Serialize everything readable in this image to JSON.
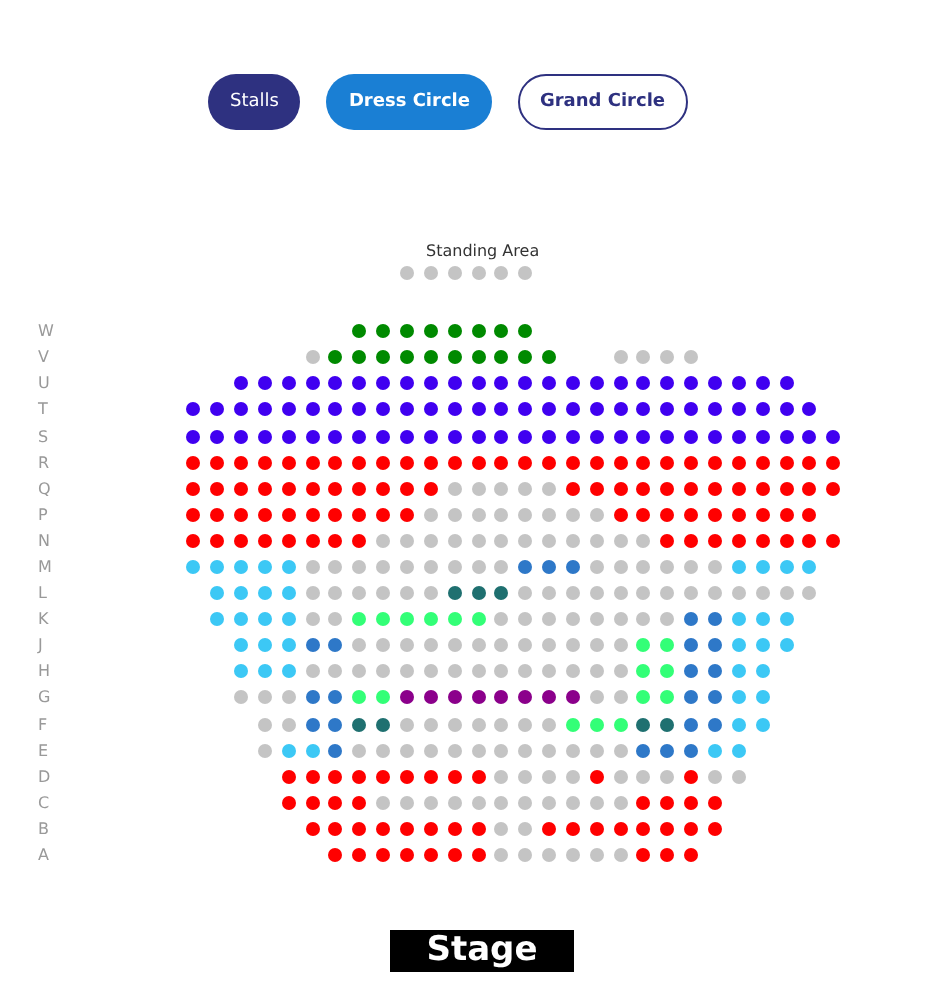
{
  "section_tabs": [
    {
      "label": "Stalls",
      "kind": "dark"
    },
    {
      "label": "Dress Circle",
      "kind": "primary"
    },
    {
      "label": "Grand Circle",
      "kind": "outline"
    }
  ],
  "standing_area": {
    "label": "Standing Area",
    "seats": [
      {
        "kind": "gap"
      },
      {
        "kind": "gap"
      },
      {
        "kind": "gap"
      },
      {
        "kind": "gap"
      },
      {
        "kind": "gap"
      },
      {
        "kind": "gap"
      },
      {
        "kind": "gap"
      },
      {
        "kind": "gap"
      },
      {
        "kind": "gap"
      },
      {
        "color": "#c4c4c4"
      },
      {
        "color": "#c4c4c4"
      },
      {
        "color": "#c4c4c4"
      },
      {
        "color": "#c4c4c4"
      },
      {
        "color": "#c4c4c4"
      },
      {
        "color": "#c4c4c4"
      }
    ]
  },
  "rows": [
    {
      "label": "W",
      "seats": [
        {
          "kind": "gap"
        },
        {
          "kind": "gap"
        },
        {
          "kind": "gap"
        },
        {
          "kind": "gap"
        },
        {
          "kind": "gap"
        },
        {
          "kind": "gap"
        },
        {
          "kind": "gap"
        },
        {
          "color": "#008a00"
        },
        {
          "color": "#008a00"
        },
        {
          "color": "#008a00"
        },
        {
          "color": "#008a00"
        },
        {
          "color": "#008a00"
        },
        {
          "color": "#008a00"
        },
        {
          "color": "#008a00"
        },
        {
          "color": "#008a00"
        }
      ]
    },
    {
      "label": "V",
      "seats": [
        {
          "kind": "gap"
        },
        {
          "kind": "gap"
        },
        {
          "kind": "gap"
        },
        {
          "kind": "gap"
        },
        {
          "kind": "gap"
        },
        {
          "color": "#c4c4c4"
        },
        {
          "color": "#008a00"
        },
        {
          "color": "#008a00"
        },
        {
          "color": "#008a00"
        },
        {
          "color": "#008a00"
        },
        {
          "color": "#008a00"
        },
        {
          "color": "#008a00"
        },
        {
          "color": "#008a00"
        },
        {
          "color": "#008a00"
        },
        {
          "color": "#008a00"
        },
        {
          "color": "#008a00"
        },
        {
          "kind": "gap"
        },
        {
          "kind": "gap"
        },
        {
          "color": "#c4c4c4"
        },
        {
          "color": "#c4c4c4"
        },
        {
          "color": "#c4c4c4"
        },
        {
          "color": "#c4c4c4"
        }
      ]
    },
    {
      "label": "U",
      "seats": [
        {
          "kind": "gap"
        },
        {
          "kind": "gap"
        },
        {
          "color": "#4000f0"
        },
        {
          "color": "#4000f0"
        },
        {
          "color": "#4000f0"
        },
        {
          "color": "#4000f0"
        },
        {
          "color": "#4000f0"
        },
        {
          "color": "#4000f0"
        },
        {
          "color": "#4000f0"
        },
        {
          "color": "#4000f0"
        },
        {
          "color": "#4000f0"
        },
        {
          "color": "#4000f0"
        },
        {
          "color": "#4000f0"
        },
        {
          "color": "#4000f0"
        },
        {
          "color": "#4000f0"
        },
        {
          "color": "#4000f0"
        },
        {
          "color": "#4000f0"
        },
        {
          "color": "#4000f0"
        },
        {
          "color": "#4000f0"
        },
        {
          "color": "#4000f0"
        },
        {
          "color": "#4000f0"
        },
        {
          "color": "#4000f0"
        },
        {
          "color": "#4000f0"
        },
        {
          "color": "#4000f0"
        },
        {
          "color": "#4000f0"
        },
        {
          "color": "#4000f0"
        }
      ]
    },
    {
      "label": "T",
      "seats": [
        {
          "color": "#4000f0"
        },
        {
          "color": "#4000f0"
        },
        {
          "color": "#4000f0"
        },
        {
          "color": "#4000f0"
        },
        {
          "color": "#4000f0"
        },
        {
          "color": "#4000f0"
        },
        {
          "color": "#4000f0"
        },
        {
          "color": "#4000f0"
        },
        {
          "color": "#4000f0"
        },
        {
          "color": "#4000f0"
        },
        {
          "color": "#4000f0"
        },
        {
          "color": "#4000f0"
        },
        {
          "color": "#4000f0"
        },
        {
          "color": "#4000f0"
        },
        {
          "color": "#4000f0"
        },
        {
          "color": "#4000f0"
        },
        {
          "color": "#4000f0"
        },
        {
          "color": "#4000f0"
        },
        {
          "color": "#4000f0"
        },
        {
          "color": "#4000f0"
        },
        {
          "color": "#4000f0"
        },
        {
          "color": "#4000f0"
        },
        {
          "color": "#4000f0"
        },
        {
          "color": "#4000f0"
        },
        {
          "color": "#4000f0"
        },
        {
          "color": "#4000f0"
        },
        {
          "color": "#4000f0"
        }
      ]
    },
    {
      "label": "S",
      "seats": [
        {
          "color": "#4000f0"
        },
        {
          "color": "#4000f0"
        },
        {
          "color": "#4000f0"
        },
        {
          "color": "#4000f0"
        },
        {
          "color": "#4000f0"
        },
        {
          "color": "#4000f0"
        },
        {
          "color": "#4000f0"
        },
        {
          "color": "#4000f0"
        },
        {
          "color": "#4000f0"
        },
        {
          "color": "#4000f0"
        },
        {
          "color": "#4000f0"
        },
        {
          "color": "#4000f0"
        },
        {
          "color": "#4000f0"
        },
        {
          "color": "#4000f0"
        },
        {
          "color": "#4000f0"
        },
        {
          "color": "#4000f0"
        },
        {
          "color": "#4000f0"
        },
        {
          "color": "#4000f0"
        },
        {
          "color": "#4000f0"
        },
        {
          "color": "#4000f0"
        },
        {
          "color": "#4000f0"
        },
        {
          "color": "#4000f0"
        },
        {
          "color": "#4000f0"
        },
        {
          "color": "#4000f0"
        },
        {
          "color": "#4000f0"
        },
        {
          "color": "#4000f0"
        },
        {
          "color": "#4000f0"
        },
        {
          "color": "#4000f0"
        }
      ]
    },
    {
      "label": "R",
      "seats": [
        {
          "color": "#ff0000"
        },
        {
          "color": "#ff0000"
        },
        {
          "color": "#ff0000"
        },
        {
          "color": "#ff0000"
        },
        {
          "color": "#ff0000"
        },
        {
          "color": "#ff0000"
        },
        {
          "color": "#ff0000"
        },
        {
          "color": "#ff0000"
        },
        {
          "color": "#ff0000"
        },
        {
          "color": "#ff0000"
        },
        {
          "color": "#ff0000"
        },
        {
          "color": "#ff0000"
        },
        {
          "color": "#ff0000"
        },
        {
          "color": "#ff0000"
        },
        {
          "color": "#ff0000"
        },
        {
          "color": "#ff0000"
        },
        {
          "color": "#ff0000"
        },
        {
          "color": "#ff0000"
        },
        {
          "color": "#ff0000"
        },
        {
          "color": "#ff0000"
        },
        {
          "color": "#ff0000"
        },
        {
          "color": "#ff0000"
        },
        {
          "color": "#ff0000"
        },
        {
          "color": "#ff0000"
        },
        {
          "color": "#ff0000"
        },
        {
          "color": "#ff0000"
        },
        {
          "color": "#ff0000"
        },
        {
          "color": "#ff0000"
        }
      ]
    },
    {
      "label": "Q",
      "seats": [
        {
          "color": "#ff0000"
        },
        {
          "color": "#ff0000"
        },
        {
          "color": "#ff0000"
        },
        {
          "color": "#ff0000"
        },
        {
          "color": "#ff0000"
        },
        {
          "color": "#ff0000"
        },
        {
          "color": "#ff0000"
        },
        {
          "color": "#ff0000"
        },
        {
          "color": "#ff0000"
        },
        {
          "color": "#ff0000"
        },
        {
          "color": "#ff0000"
        },
        {
          "color": "#c4c4c4"
        },
        {
          "color": "#c4c4c4"
        },
        {
          "color": "#c4c4c4"
        },
        {
          "color": "#c4c4c4"
        },
        {
          "color": "#c4c4c4"
        },
        {
          "color": "#ff0000"
        },
        {
          "color": "#ff0000"
        },
        {
          "color": "#ff0000"
        },
        {
          "color": "#ff0000"
        },
        {
          "color": "#ff0000"
        },
        {
          "color": "#ff0000"
        },
        {
          "color": "#ff0000"
        },
        {
          "color": "#ff0000"
        },
        {
          "color": "#ff0000"
        },
        {
          "color": "#ff0000"
        },
        {
          "color": "#ff0000"
        },
        {
          "color": "#ff0000"
        }
      ]
    },
    {
      "label": "P",
      "seats": [
        {
          "color": "#ff0000"
        },
        {
          "color": "#ff0000"
        },
        {
          "color": "#ff0000"
        },
        {
          "color": "#ff0000"
        },
        {
          "color": "#ff0000"
        },
        {
          "color": "#ff0000"
        },
        {
          "color": "#ff0000"
        },
        {
          "color": "#ff0000"
        },
        {
          "color": "#ff0000"
        },
        {
          "color": "#ff0000"
        },
        {
          "color": "#c4c4c4"
        },
        {
          "color": "#c4c4c4"
        },
        {
          "color": "#c4c4c4"
        },
        {
          "color": "#c4c4c4"
        },
        {
          "color": "#c4c4c4"
        },
        {
          "color": "#c4c4c4"
        },
        {
          "color": "#c4c4c4"
        },
        {
          "color": "#c4c4c4"
        },
        {
          "color": "#ff0000"
        },
        {
          "color": "#ff0000"
        },
        {
          "color": "#ff0000"
        },
        {
          "color": "#ff0000"
        },
        {
          "color": "#ff0000"
        },
        {
          "color": "#ff0000"
        },
        {
          "color": "#ff0000"
        },
        {
          "color": "#ff0000"
        },
        {
          "color": "#ff0000"
        }
      ]
    },
    {
      "label": "N",
      "seats": [
        {
          "color": "#ff0000"
        },
        {
          "color": "#ff0000"
        },
        {
          "color": "#ff0000"
        },
        {
          "color": "#ff0000"
        },
        {
          "color": "#ff0000"
        },
        {
          "color": "#ff0000"
        },
        {
          "color": "#ff0000"
        },
        {
          "color": "#ff0000"
        },
        {
          "color": "#c4c4c4"
        },
        {
          "color": "#c4c4c4"
        },
        {
          "color": "#c4c4c4"
        },
        {
          "color": "#c4c4c4"
        },
        {
          "color": "#c4c4c4"
        },
        {
          "color": "#c4c4c4"
        },
        {
          "color": "#c4c4c4"
        },
        {
          "color": "#c4c4c4"
        },
        {
          "color": "#c4c4c4"
        },
        {
          "color": "#c4c4c4"
        },
        {
          "color": "#c4c4c4"
        },
        {
          "color": "#c4c4c4"
        },
        {
          "color": "#ff0000"
        },
        {
          "color": "#ff0000"
        },
        {
          "color": "#ff0000"
        },
        {
          "color": "#ff0000"
        },
        {
          "color": "#ff0000"
        },
        {
          "color": "#ff0000"
        },
        {
          "color": "#ff0000"
        },
        {
          "color": "#ff0000"
        }
      ]
    },
    {
      "label": "M",
      "seats": [
        {
          "color": "#3cc8f5"
        },
        {
          "color": "#3cc8f5"
        },
        {
          "color": "#3cc8f5"
        },
        {
          "color": "#3cc8f5"
        },
        {
          "color": "#3cc8f5"
        },
        {
          "color": "#c4c4c4"
        },
        {
          "color": "#c4c4c4"
        },
        {
          "color": "#c4c4c4"
        },
        {
          "color": "#c4c4c4"
        },
        {
          "color": "#c4c4c4"
        },
        {
          "color": "#c4c4c4"
        },
        {
          "color": "#c4c4c4"
        },
        {
          "color": "#c4c4c4"
        },
        {
          "color": "#c4c4c4"
        },
        {
          "color": "#2e78c8"
        },
        {
          "color": "#2e78c8"
        },
        {
          "color": "#2e78c8"
        },
        {
          "color": "#c4c4c4"
        },
        {
          "color": "#c4c4c4"
        },
        {
          "color": "#c4c4c4"
        },
        {
          "color": "#c4c4c4"
        },
        {
          "color": "#c4c4c4"
        },
        {
          "color": "#c4c4c4"
        },
        {
          "color": "#3cc8f5"
        },
        {
          "color": "#3cc8f5"
        },
        {
          "color": "#3cc8f5"
        },
        {
          "color": "#3cc8f5"
        }
      ]
    },
    {
      "label": "L",
      "seats": [
        {
          "kind": "gap"
        },
        {
          "color": "#3cc8f5"
        },
        {
          "color": "#3cc8f5"
        },
        {
          "color": "#3cc8f5"
        },
        {
          "color": "#3cc8f5"
        },
        {
          "color": "#c4c4c4"
        },
        {
          "color": "#c4c4c4"
        },
        {
          "color": "#c4c4c4"
        },
        {
          "color": "#c4c4c4"
        },
        {
          "color": "#c4c4c4"
        },
        {
          "color": "#c4c4c4"
        },
        {
          "color": "#1f7070"
        },
        {
          "color": "#1f7070"
        },
        {
          "color": "#1f7070"
        },
        {
          "color": "#c4c4c4"
        },
        {
          "color": "#c4c4c4"
        },
        {
          "color": "#c4c4c4"
        },
        {
          "color": "#c4c4c4"
        },
        {
          "color": "#c4c4c4"
        },
        {
          "color": "#c4c4c4"
        },
        {
          "color": "#c4c4c4"
        },
        {
          "color": "#c4c4c4"
        },
        {
          "color": "#c4c4c4"
        },
        {
          "color": "#c4c4c4"
        },
        {
          "color": "#c4c4c4"
        },
        {
          "color": "#c4c4c4"
        },
        {
          "color": "#c4c4c4"
        }
      ]
    },
    {
      "label": "K",
      "seats": [
        {
          "kind": "gap"
        },
        {
          "color": "#3cc8f5"
        },
        {
          "color": "#3cc8f5"
        },
        {
          "color": "#3cc8f5"
        },
        {
          "color": "#3cc8f5"
        },
        {
          "color": "#c4c4c4"
        },
        {
          "color": "#c4c4c4"
        },
        {
          "color": "#33ff77"
        },
        {
          "color": "#33ff77"
        },
        {
          "color": "#33ff77"
        },
        {
          "color": "#33ff77"
        },
        {
          "color": "#33ff77"
        },
        {
          "color": "#33ff77"
        },
        {
          "color": "#c4c4c4"
        },
        {
          "color": "#c4c4c4"
        },
        {
          "color": "#c4c4c4"
        },
        {
          "color": "#c4c4c4"
        },
        {
          "color": "#c4c4c4"
        },
        {
          "color": "#c4c4c4"
        },
        {
          "color": "#c4c4c4"
        },
        {
          "color": "#c4c4c4"
        },
        {
          "color": "#2e78c8"
        },
        {
          "color": "#2e78c8"
        },
        {
          "color": "#3cc8f5"
        },
        {
          "color": "#3cc8f5"
        },
        {
          "color": "#3cc8f5"
        }
      ]
    },
    {
      "label": "J",
      "seats": [
        {
          "kind": "gap"
        },
        {
          "kind": "gap"
        },
        {
          "color": "#3cc8f5"
        },
        {
          "color": "#3cc8f5"
        },
        {
          "color": "#3cc8f5"
        },
        {
          "color": "#2e78c8"
        },
        {
          "color": "#2e78c8"
        },
        {
          "color": "#c4c4c4"
        },
        {
          "color": "#c4c4c4"
        },
        {
          "color": "#c4c4c4"
        },
        {
          "color": "#c4c4c4"
        },
        {
          "color": "#c4c4c4"
        },
        {
          "color": "#c4c4c4"
        },
        {
          "color": "#c4c4c4"
        },
        {
          "color": "#c4c4c4"
        },
        {
          "color": "#c4c4c4"
        },
        {
          "color": "#c4c4c4"
        },
        {
          "color": "#c4c4c4"
        },
        {
          "color": "#c4c4c4"
        },
        {
          "color": "#33ff77"
        },
        {
          "color": "#33ff77"
        },
        {
          "color": "#2e78c8"
        },
        {
          "color": "#2e78c8"
        },
        {
          "color": "#3cc8f5"
        },
        {
          "color": "#3cc8f5"
        },
        {
          "color": "#3cc8f5"
        }
      ]
    },
    {
      "label": "H",
      "seats": [
        {
          "kind": "gap"
        },
        {
          "kind": "gap"
        },
        {
          "color": "#3cc8f5"
        },
        {
          "color": "#3cc8f5"
        },
        {
          "color": "#3cc8f5"
        },
        {
          "color": "#c4c4c4"
        },
        {
          "color": "#c4c4c4"
        },
        {
          "color": "#c4c4c4"
        },
        {
          "color": "#c4c4c4"
        },
        {
          "color": "#c4c4c4"
        },
        {
          "color": "#c4c4c4"
        },
        {
          "color": "#c4c4c4"
        },
        {
          "color": "#c4c4c4"
        },
        {
          "color": "#c4c4c4"
        },
        {
          "color": "#c4c4c4"
        },
        {
          "color": "#c4c4c4"
        },
        {
          "color": "#c4c4c4"
        },
        {
          "color": "#c4c4c4"
        },
        {
          "color": "#c4c4c4"
        },
        {
          "color": "#33ff77"
        },
        {
          "color": "#33ff77"
        },
        {
          "color": "#2e78c8"
        },
        {
          "color": "#2e78c8"
        },
        {
          "color": "#3cc8f5"
        },
        {
          "color": "#3cc8f5"
        }
      ]
    },
    {
      "label": "G",
      "seats": [
        {
          "kind": "gap"
        },
        {
          "kind": "gap"
        },
        {
          "color": "#c4c4c4"
        },
        {
          "color": "#c4c4c4"
        },
        {
          "color": "#c4c4c4"
        },
        {
          "color": "#2e78c8"
        },
        {
          "color": "#2e78c8"
        },
        {
          "color": "#33ff77"
        },
        {
          "color": "#33ff77"
        },
        {
          "color": "#8b008b"
        },
        {
          "color": "#8b008b"
        },
        {
          "color": "#8b008b"
        },
        {
          "color": "#8b008b"
        },
        {
          "color": "#8b008b"
        },
        {
          "color": "#8b008b"
        },
        {
          "color": "#8b008b"
        },
        {
          "color": "#8b008b"
        },
        {
          "color": "#c4c4c4"
        },
        {
          "color": "#c4c4c4"
        },
        {
          "color": "#33ff77"
        },
        {
          "color": "#33ff77"
        },
        {
          "color": "#2e78c8"
        },
        {
          "color": "#2e78c8"
        },
        {
          "color": "#3cc8f5"
        },
        {
          "color": "#3cc8f5"
        }
      ]
    },
    {
      "label": "F",
      "seats": [
        {
          "kind": "gap"
        },
        {
          "kind": "gap"
        },
        {
          "kind": "gap"
        },
        {
          "color": "#c4c4c4"
        },
        {
          "color": "#c4c4c4"
        },
        {
          "color": "#2e78c8"
        },
        {
          "color": "#2e78c8"
        },
        {
          "color": "#1f7070"
        },
        {
          "color": "#1f7070"
        },
        {
          "color": "#c4c4c4"
        },
        {
          "color": "#c4c4c4"
        },
        {
          "color": "#c4c4c4"
        },
        {
          "color": "#c4c4c4"
        },
        {
          "color": "#c4c4c4"
        },
        {
          "color": "#c4c4c4"
        },
        {
          "color": "#c4c4c4"
        },
        {
          "color": "#33ff77"
        },
        {
          "color": "#33ff77"
        },
        {
          "color": "#33ff77"
        },
        {
          "color": "#1f7070"
        },
        {
          "color": "#1f7070"
        },
        {
          "color": "#2e78c8"
        },
        {
          "color": "#2e78c8"
        },
        {
          "color": "#3cc8f5"
        },
        {
          "color": "#3cc8f5"
        }
      ]
    },
    {
      "label": "E",
      "seats": [
        {
          "kind": "gap"
        },
        {
          "kind": "gap"
        },
        {
          "kind": "gap"
        },
        {
          "color": "#c4c4c4"
        },
        {
          "color": "#3cc8f5"
        },
        {
          "color": "#3cc8f5"
        },
        {
          "color": "#2e78c8"
        },
        {
          "color": "#c4c4c4"
        },
        {
          "color": "#c4c4c4"
        },
        {
          "color": "#c4c4c4"
        },
        {
          "color": "#c4c4c4"
        },
        {
          "color": "#c4c4c4"
        },
        {
          "color": "#c4c4c4"
        },
        {
          "color": "#c4c4c4"
        },
        {
          "color": "#c4c4c4"
        },
        {
          "color": "#c4c4c4"
        },
        {
          "color": "#c4c4c4"
        },
        {
          "color": "#c4c4c4"
        },
        {
          "color": "#c4c4c4"
        },
        {
          "color": "#2e78c8"
        },
        {
          "color": "#2e78c8"
        },
        {
          "color": "#2e78c8"
        },
        {
          "color": "#3cc8f5"
        },
        {
          "color": "#3cc8f5"
        }
      ]
    },
    {
      "label": "D",
      "seats": [
        {
          "kind": "gap"
        },
        {
          "kind": "gap"
        },
        {
          "kind": "gap"
        },
        {
          "kind": "gap"
        },
        {
          "color": "#ff0000"
        },
        {
          "color": "#ff0000"
        },
        {
          "color": "#ff0000"
        },
        {
          "color": "#ff0000"
        },
        {
          "color": "#ff0000"
        },
        {
          "color": "#ff0000"
        },
        {
          "color": "#ff0000"
        },
        {
          "color": "#ff0000"
        },
        {
          "color": "#ff0000"
        },
        {
          "color": "#c4c4c4"
        },
        {
          "color": "#c4c4c4"
        },
        {
          "color": "#c4c4c4"
        },
        {
          "color": "#c4c4c4"
        },
        {
          "color": "#ff0000"
        },
        {
          "color": "#c4c4c4"
        },
        {
          "color": "#c4c4c4"
        },
        {
          "color": "#c4c4c4"
        },
        {
          "color": "#ff0000"
        },
        {
          "color": "#c4c4c4"
        },
        {
          "color": "#c4c4c4"
        }
      ]
    },
    {
      "label": "C",
      "seats": [
        {
          "kind": "gap"
        },
        {
          "kind": "gap"
        },
        {
          "kind": "gap"
        },
        {
          "kind": "gap"
        },
        {
          "color": "#ff0000"
        },
        {
          "color": "#ff0000"
        },
        {
          "color": "#ff0000"
        },
        {
          "color": "#ff0000"
        },
        {
          "color": "#c4c4c4"
        },
        {
          "color": "#c4c4c4"
        },
        {
          "color": "#c4c4c4"
        },
        {
          "color": "#c4c4c4"
        },
        {
          "color": "#c4c4c4"
        },
        {
          "color": "#c4c4c4"
        },
        {
          "color": "#c4c4c4"
        },
        {
          "color": "#c4c4c4"
        },
        {
          "color": "#c4c4c4"
        },
        {
          "color": "#c4c4c4"
        },
        {
          "color": "#c4c4c4"
        },
        {
          "color": "#ff0000"
        },
        {
          "color": "#ff0000"
        },
        {
          "color": "#ff0000"
        },
        {
          "color": "#ff0000"
        }
      ]
    },
    {
      "label": "B",
      "seats": [
        {
          "kind": "gap"
        },
        {
          "kind": "gap"
        },
        {
          "kind": "gap"
        },
        {
          "kind": "gap"
        },
        {
          "kind": "gap"
        },
        {
          "color": "#ff0000"
        },
        {
          "color": "#ff0000"
        },
        {
          "color": "#ff0000"
        },
        {
          "color": "#ff0000"
        },
        {
          "color": "#ff0000"
        },
        {
          "color": "#ff0000"
        },
        {
          "color": "#ff0000"
        },
        {
          "color": "#ff0000"
        },
        {
          "color": "#c4c4c4"
        },
        {
          "color": "#c4c4c4"
        },
        {
          "color": "#ff0000"
        },
        {
          "color": "#ff0000"
        },
        {
          "color": "#ff0000"
        },
        {
          "color": "#ff0000"
        },
        {
          "color": "#ff0000"
        },
        {
          "color": "#ff0000"
        },
        {
          "color": "#ff0000"
        },
        {
          "color": "#ff0000"
        }
      ]
    },
    {
      "label": "A",
      "seats": [
        {
          "kind": "gap"
        },
        {
          "kind": "gap"
        },
        {
          "kind": "gap"
        },
        {
          "kind": "gap"
        },
        {
          "kind": "gap"
        },
        {
          "kind": "gap"
        },
        {
          "color": "#ff0000"
        },
        {
          "color": "#ff0000"
        },
        {
          "color": "#ff0000"
        },
        {
          "color": "#ff0000"
        },
        {
          "color": "#ff0000"
        },
        {
          "color": "#ff0000"
        },
        {
          "color": "#ff0000"
        },
        {
          "color": "#c4c4c4"
        },
        {
          "color": "#c4c4c4"
        },
        {
          "color": "#c4c4c4"
        },
        {
          "color": "#c4c4c4"
        },
        {
          "color": "#c4c4c4"
        },
        {
          "color": "#c4c4c4"
        },
        {
          "color": "#ff0000"
        },
        {
          "color": "#ff0000"
        },
        {
          "color": "#ff0000"
        }
      ]
    }
  ],
  "stage": {
    "label": "Stage"
  }
}
